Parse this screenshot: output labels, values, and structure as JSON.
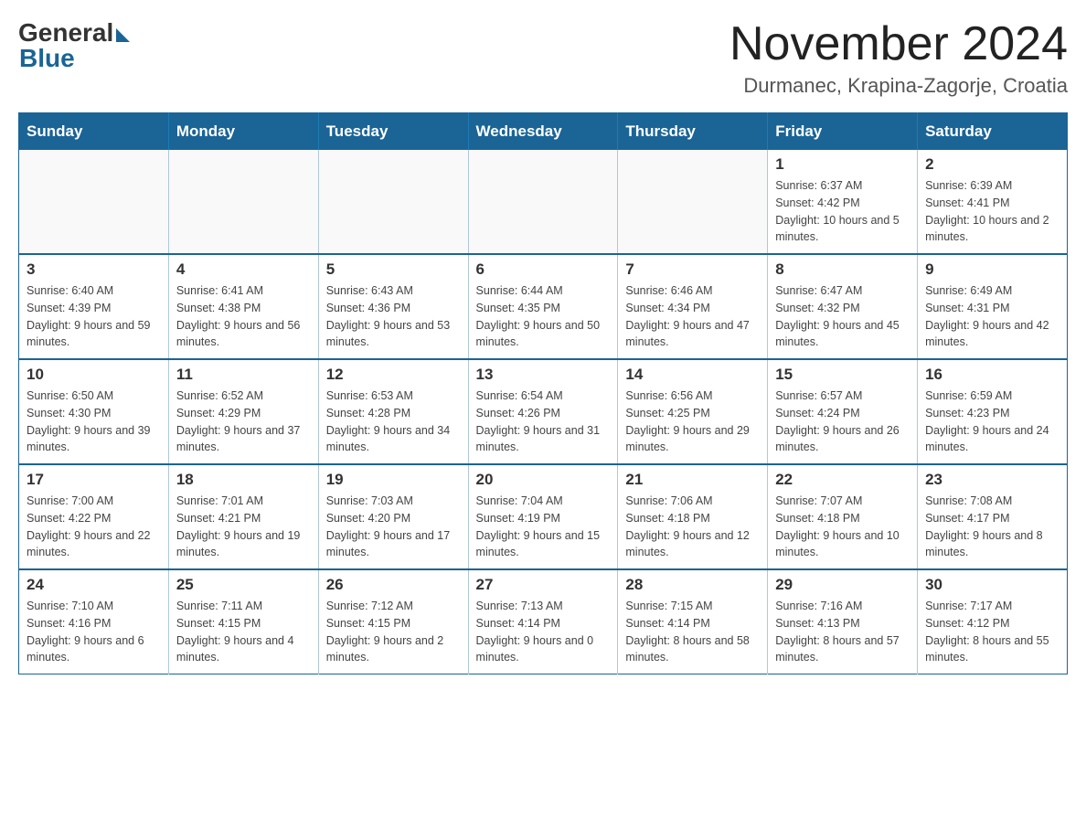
{
  "header": {
    "month_title": "November 2024",
    "location": "Durmanec, Krapina-Zagorje, Croatia"
  },
  "logo": {
    "general": "General",
    "blue": "Blue"
  },
  "days_of_week": [
    "Sunday",
    "Monday",
    "Tuesday",
    "Wednesday",
    "Thursday",
    "Friday",
    "Saturday"
  ],
  "weeks": [
    [
      {
        "day": "",
        "info": ""
      },
      {
        "day": "",
        "info": ""
      },
      {
        "day": "",
        "info": ""
      },
      {
        "day": "",
        "info": ""
      },
      {
        "day": "",
        "info": ""
      },
      {
        "day": "1",
        "info": "Sunrise: 6:37 AM\nSunset: 4:42 PM\nDaylight: 10 hours and 5 minutes."
      },
      {
        "day": "2",
        "info": "Sunrise: 6:39 AM\nSunset: 4:41 PM\nDaylight: 10 hours and 2 minutes."
      }
    ],
    [
      {
        "day": "3",
        "info": "Sunrise: 6:40 AM\nSunset: 4:39 PM\nDaylight: 9 hours and 59 minutes."
      },
      {
        "day": "4",
        "info": "Sunrise: 6:41 AM\nSunset: 4:38 PM\nDaylight: 9 hours and 56 minutes."
      },
      {
        "day": "5",
        "info": "Sunrise: 6:43 AM\nSunset: 4:36 PM\nDaylight: 9 hours and 53 minutes."
      },
      {
        "day": "6",
        "info": "Sunrise: 6:44 AM\nSunset: 4:35 PM\nDaylight: 9 hours and 50 minutes."
      },
      {
        "day": "7",
        "info": "Sunrise: 6:46 AM\nSunset: 4:34 PM\nDaylight: 9 hours and 47 minutes."
      },
      {
        "day": "8",
        "info": "Sunrise: 6:47 AM\nSunset: 4:32 PM\nDaylight: 9 hours and 45 minutes."
      },
      {
        "day": "9",
        "info": "Sunrise: 6:49 AM\nSunset: 4:31 PM\nDaylight: 9 hours and 42 minutes."
      }
    ],
    [
      {
        "day": "10",
        "info": "Sunrise: 6:50 AM\nSunset: 4:30 PM\nDaylight: 9 hours and 39 minutes."
      },
      {
        "day": "11",
        "info": "Sunrise: 6:52 AM\nSunset: 4:29 PM\nDaylight: 9 hours and 37 minutes."
      },
      {
        "day": "12",
        "info": "Sunrise: 6:53 AM\nSunset: 4:28 PM\nDaylight: 9 hours and 34 minutes."
      },
      {
        "day": "13",
        "info": "Sunrise: 6:54 AM\nSunset: 4:26 PM\nDaylight: 9 hours and 31 minutes."
      },
      {
        "day": "14",
        "info": "Sunrise: 6:56 AM\nSunset: 4:25 PM\nDaylight: 9 hours and 29 minutes."
      },
      {
        "day": "15",
        "info": "Sunrise: 6:57 AM\nSunset: 4:24 PM\nDaylight: 9 hours and 26 minutes."
      },
      {
        "day": "16",
        "info": "Sunrise: 6:59 AM\nSunset: 4:23 PM\nDaylight: 9 hours and 24 minutes."
      }
    ],
    [
      {
        "day": "17",
        "info": "Sunrise: 7:00 AM\nSunset: 4:22 PM\nDaylight: 9 hours and 22 minutes."
      },
      {
        "day": "18",
        "info": "Sunrise: 7:01 AM\nSunset: 4:21 PM\nDaylight: 9 hours and 19 minutes."
      },
      {
        "day": "19",
        "info": "Sunrise: 7:03 AM\nSunset: 4:20 PM\nDaylight: 9 hours and 17 minutes."
      },
      {
        "day": "20",
        "info": "Sunrise: 7:04 AM\nSunset: 4:19 PM\nDaylight: 9 hours and 15 minutes."
      },
      {
        "day": "21",
        "info": "Sunrise: 7:06 AM\nSunset: 4:18 PM\nDaylight: 9 hours and 12 minutes."
      },
      {
        "day": "22",
        "info": "Sunrise: 7:07 AM\nSunset: 4:18 PM\nDaylight: 9 hours and 10 minutes."
      },
      {
        "day": "23",
        "info": "Sunrise: 7:08 AM\nSunset: 4:17 PM\nDaylight: 9 hours and 8 minutes."
      }
    ],
    [
      {
        "day": "24",
        "info": "Sunrise: 7:10 AM\nSunset: 4:16 PM\nDaylight: 9 hours and 6 minutes."
      },
      {
        "day": "25",
        "info": "Sunrise: 7:11 AM\nSunset: 4:15 PM\nDaylight: 9 hours and 4 minutes."
      },
      {
        "day": "26",
        "info": "Sunrise: 7:12 AM\nSunset: 4:15 PM\nDaylight: 9 hours and 2 minutes."
      },
      {
        "day": "27",
        "info": "Sunrise: 7:13 AM\nSunset: 4:14 PM\nDaylight: 9 hours and 0 minutes."
      },
      {
        "day": "28",
        "info": "Sunrise: 7:15 AM\nSunset: 4:14 PM\nDaylight: 8 hours and 58 minutes."
      },
      {
        "day": "29",
        "info": "Sunrise: 7:16 AM\nSunset: 4:13 PM\nDaylight: 8 hours and 57 minutes."
      },
      {
        "day": "30",
        "info": "Sunrise: 7:17 AM\nSunset: 4:12 PM\nDaylight: 8 hours and 55 minutes."
      }
    ]
  ]
}
